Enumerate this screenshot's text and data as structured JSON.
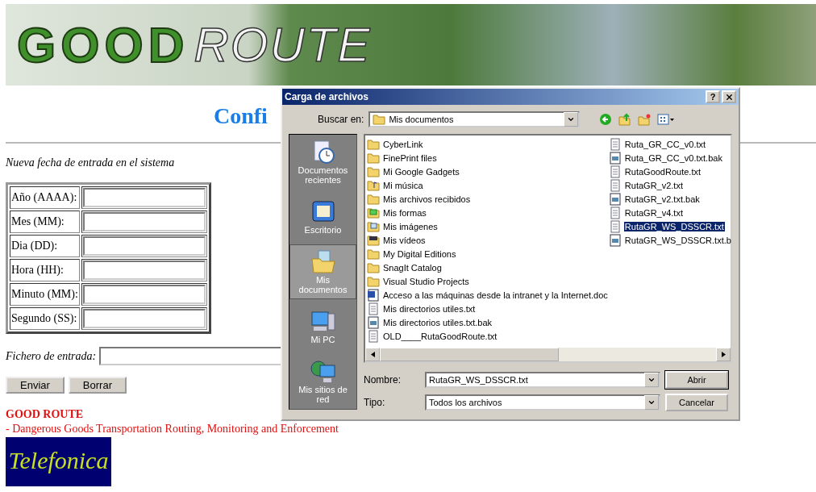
{
  "banner": {
    "logo_word_1": "GOOD",
    "logo_word_2": "ROUTE"
  },
  "page": {
    "title": "Confi",
    "subtitle": "Nueva fecha de entrada en el sistema",
    "date_fields": [
      {
        "label": "Año (AAAA):"
      },
      {
        "label": "Mes (MM):"
      },
      {
        "label": "Dia (DD):"
      },
      {
        "label": "Hora (HH):"
      },
      {
        "label": "Minuto (MM):"
      },
      {
        "label": "Segundo (SS):"
      }
    ],
    "file_field": {
      "label": "Fichero de entrada:"
    },
    "buttons": [
      "Enviar",
      "Borrar"
    ],
    "footer_title": "GOOD ROUTE",
    "footer_text": "- Dangerous Goods Transportation Routing, Monitoring and Enforcement",
    "sponsor_logo": "Telefonica"
  },
  "dialog": {
    "title": "Carga de archivos",
    "help": "?",
    "look_in_label": "Buscar en:",
    "look_in_value": "Mis documentos",
    "places": [
      {
        "label": "Documentos recientes",
        "kind": "recent",
        "selected": false
      },
      {
        "label": "Escritorio",
        "kind": "desktop",
        "selected": false
      },
      {
        "label": "Mis documentos",
        "kind": "documents",
        "selected": true
      },
      {
        "label": "Mi PC",
        "kind": "computer",
        "selected": false
      },
      {
        "label": "Mis sitios de red",
        "kind": "network",
        "selected": false
      }
    ],
    "file_columns": [
      [
        {
          "name": "CyberLink",
          "kind": "folder",
          "selected": false
        },
        {
          "name": "FinePrint files",
          "kind": "folder",
          "selected": false
        },
        {
          "name": "Mi Google Gadgets",
          "kind": "folder",
          "selected": false
        },
        {
          "name": "Mi música",
          "kind": "music",
          "selected": false
        },
        {
          "name": "Mis archivos recibidos",
          "kind": "folder",
          "selected": false
        },
        {
          "name": "Mis formas",
          "kind": "forms",
          "selected": false
        },
        {
          "name": "Mis imágenes",
          "kind": "images",
          "selected": false
        },
        {
          "name": "Mis vídeos",
          "kind": "videos",
          "selected": false
        },
        {
          "name": "My Digital Editions",
          "kind": "folder",
          "selected": false
        },
        {
          "name": "SnagIt Catalog",
          "kind": "folder",
          "selected": false
        },
        {
          "name": "Visual Studio Projects",
          "kind": "folder",
          "selected": false
        },
        {
          "name": "Acceso a las máquinas desde la intranet y la Internet.doc",
          "kind": "doc",
          "selected": false
        },
        {
          "name": "Mis directorios utiles.txt",
          "kind": "text",
          "selected": false
        },
        {
          "name": "Mis directorios utiles.txt.bak",
          "kind": "bak",
          "selected": false
        },
        {
          "name": "OLD____RutaGoodRoute.txt",
          "kind": "text",
          "selected": false
        }
      ],
      [
        {
          "name": "Ruta_GR_CC_v0.txt",
          "kind": "text",
          "selected": false
        },
        {
          "name": "Ruta_GR_CC_v0.txt.bak",
          "kind": "bak",
          "selected": false
        },
        {
          "name": "RutaGoodRoute.txt",
          "kind": "text",
          "selected": false
        },
        {
          "name": "RutaGR_v2.txt",
          "kind": "text",
          "selected": false
        },
        {
          "name": "RutaGR_v2.txt.bak",
          "kind": "bak",
          "selected": false
        },
        {
          "name": "RutaGR_v4.txt",
          "kind": "text",
          "selected": false
        },
        {
          "name": "RutaGR_WS_DSSCR.txt",
          "kind": "text",
          "selected": true
        },
        {
          "name": "RutaGR_WS_DSSCR.txt.b",
          "kind": "bak",
          "selected": false
        }
      ]
    ],
    "name_label": "Nombre:",
    "name_value": "RutaGR_WS_DSSCR.txt",
    "type_label": "Tipo:",
    "type_value": "Todos los archivos",
    "buttons": [
      "Abrir",
      "Cancelar"
    ]
  }
}
